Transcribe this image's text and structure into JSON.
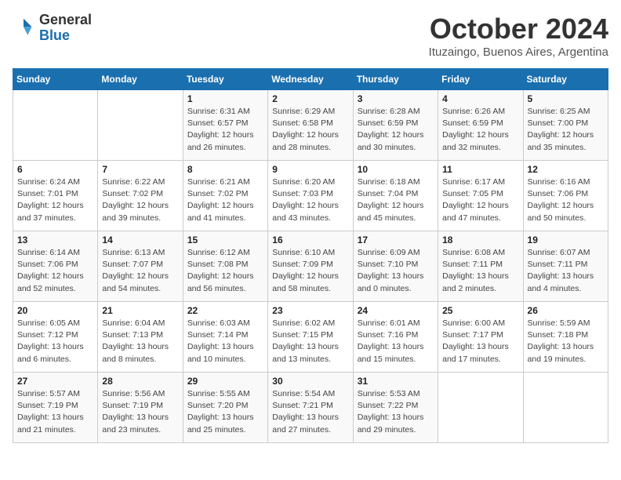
{
  "header": {
    "logo_general": "General",
    "logo_blue": "Blue",
    "month": "October 2024",
    "location": "Ituzaingo, Buenos Aires, Argentina"
  },
  "days_of_week": [
    "Sunday",
    "Monday",
    "Tuesday",
    "Wednesday",
    "Thursday",
    "Friday",
    "Saturday"
  ],
  "weeks": [
    [
      {
        "day": "",
        "info": ""
      },
      {
        "day": "",
        "info": ""
      },
      {
        "day": "1",
        "info": "Sunrise: 6:31 AM\nSunset: 6:57 PM\nDaylight: 12 hours and 26 minutes."
      },
      {
        "day": "2",
        "info": "Sunrise: 6:29 AM\nSunset: 6:58 PM\nDaylight: 12 hours and 28 minutes."
      },
      {
        "day": "3",
        "info": "Sunrise: 6:28 AM\nSunset: 6:59 PM\nDaylight: 12 hours and 30 minutes."
      },
      {
        "day": "4",
        "info": "Sunrise: 6:26 AM\nSunset: 6:59 PM\nDaylight: 12 hours and 32 minutes."
      },
      {
        "day": "5",
        "info": "Sunrise: 6:25 AM\nSunset: 7:00 PM\nDaylight: 12 hours and 35 minutes."
      }
    ],
    [
      {
        "day": "6",
        "info": "Sunrise: 6:24 AM\nSunset: 7:01 PM\nDaylight: 12 hours and 37 minutes."
      },
      {
        "day": "7",
        "info": "Sunrise: 6:22 AM\nSunset: 7:02 PM\nDaylight: 12 hours and 39 minutes."
      },
      {
        "day": "8",
        "info": "Sunrise: 6:21 AM\nSunset: 7:02 PM\nDaylight: 12 hours and 41 minutes."
      },
      {
        "day": "9",
        "info": "Sunrise: 6:20 AM\nSunset: 7:03 PM\nDaylight: 12 hours and 43 minutes."
      },
      {
        "day": "10",
        "info": "Sunrise: 6:18 AM\nSunset: 7:04 PM\nDaylight: 12 hours and 45 minutes."
      },
      {
        "day": "11",
        "info": "Sunrise: 6:17 AM\nSunset: 7:05 PM\nDaylight: 12 hours and 47 minutes."
      },
      {
        "day": "12",
        "info": "Sunrise: 6:16 AM\nSunset: 7:06 PM\nDaylight: 12 hours and 50 minutes."
      }
    ],
    [
      {
        "day": "13",
        "info": "Sunrise: 6:14 AM\nSunset: 7:06 PM\nDaylight: 12 hours and 52 minutes."
      },
      {
        "day": "14",
        "info": "Sunrise: 6:13 AM\nSunset: 7:07 PM\nDaylight: 12 hours and 54 minutes."
      },
      {
        "day": "15",
        "info": "Sunrise: 6:12 AM\nSunset: 7:08 PM\nDaylight: 12 hours and 56 minutes."
      },
      {
        "day": "16",
        "info": "Sunrise: 6:10 AM\nSunset: 7:09 PM\nDaylight: 12 hours and 58 minutes."
      },
      {
        "day": "17",
        "info": "Sunrise: 6:09 AM\nSunset: 7:10 PM\nDaylight: 13 hours and 0 minutes."
      },
      {
        "day": "18",
        "info": "Sunrise: 6:08 AM\nSunset: 7:11 PM\nDaylight: 13 hours and 2 minutes."
      },
      {
        "day": "19",
        "info": "Sunrise: 6:07 AM\nSunset: 7:11 PM\nDaylight: 13 hours and 4 minutes."
      }
    ],
    [
      {
        "day": "20",
        "info": "Sunrise: 6:05 AM\nSunset: 7:12 PM\nDaylight: 13 hours and 6 minutes."
      },
      {
        "day": "21",
        "info": "Sunrise: 6:04 AM\nSunset: 7:13 PM\nDaylight: 13 hours and 8 minutes."
      },
      {
        "day": "22",
        "info": "Sunrise: 6:03 AM\nSunset: 7:14 PM\nDaylight: 13 hours and 10 minutes."
      },
      {
        "day": "23",
        "info": "Sunrise: 6:02 AM\nSunset: 7:15 PM\nDaylight: 13 hours and 13 minutes."
      },
      {
        "day": "24",
        "info": "Sunrise: 6:01 AM\nSunset: 7:16 PM\nDaylight: 13 hours and 15 minutes."
      },
      {
        "day": "25",
        "info": "Sunrise: 6:00 AM\nSunset: 7:17 PM\nDaylight: 13 hours and 17 minutes."
      },
      {
        "day": "26",
        "info": "Sunrise: 5:59 AM\nSunset: 7:18 PM\nDaylight: 13 hours and 19 minutes."
      }
    ],
    [
      {
        "day": "27",
        "info": "Sunrise: 5:57 AM\nSunset: 7:19 PM\nDaylight: 13 hours and 21 minutes."
      },
      {
        "day": "28",
        "info": "Sunrise: 5:56 AM\nSunset: 7:19 PM\nDaylight: 13 hours and 23 minutes."
      },
      {
        "day": "29",
        "info": "Sunrise: 5:55 AM\nSunset: 7:20 PM\nDaylight: 13 hours and 25 minutes."
      },
      {
        "day": "30",
        "info": "Sunrise: 5:54 AM\nSunset: 7:21 PM\nDaylight: 13 hours and 27 minutes."
      },
      {
        "day": "31",
        "info": "Sunrise: 5:53 AM\nSunset: 7:22 PM\nDaylight: 13 hours and 29 minutes."
      },
      {
        "day": "",
        "info": ""
      },
      {
        "day": "",
        "info": ""
      }
    ]
  ]
}
